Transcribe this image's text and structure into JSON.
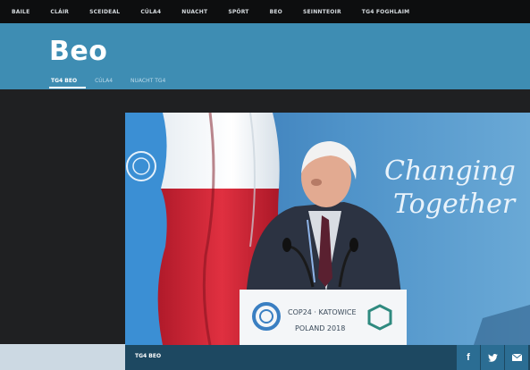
{
  "nav": {
    "items": [
      "BAILE",
      "CLÁIR",
      "SCEIDEAL",
      "CÚLA4",
      "NUACHT",
      "SPÓRT",
      "BEO",
      "SEINNTEOIR",
      "TG4 FOGHLAIM"
    ]
  },
  "header": {
    "title": "Beo",
    "tabs": [
      "TG4 BEO",
      "CÚLA4",
      "NUACHT TG4"
    ],
    "active_tab": "TG4 BEO"
  },
  "video": {
    "backdrop_line1": "Changing",
    "backdrop_line2": "Together",
    "lectern_text1": "COP24 · KATOWICE",
    "lectern_text2": "POLAND 2018"
  },
  "bottom_bar": {
    "label": "TG4 BEO",
    "share_icons": [
      "facebook-icon",
      "twitter-icon",
      "mail-icon"
    ]
  },
  "colors": {
    "nav_bg": "#0d0e0f",
    "header_bg": "#3e8db3",
    "page_bg": "#1f2022",
    "bottom_bar_bg": "#1d4861",
    "share_bg": "#2b6d93"
  }
}
